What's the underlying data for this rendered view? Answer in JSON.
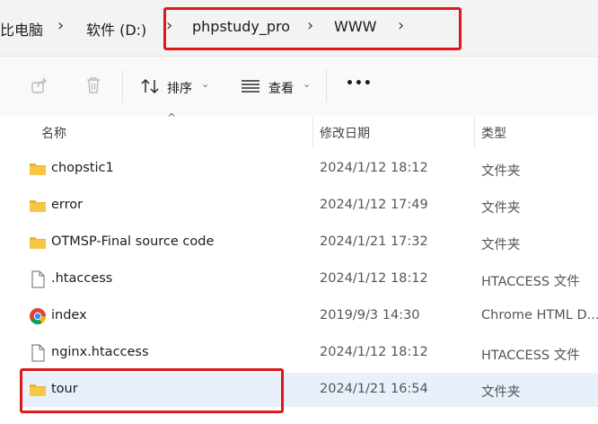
{
  "breadcrumb": {
    "items": [
      "比电脑",
      "软件 (D:)",
      "phpstudy_pro",
      "WWW"
    ]
  },
  "toolbar": {
    "sort_label": "排序",
    "view_label": "查看",
    "more_label": "•••"
  },
  "columns": {
    "name": "名称",
    "date": "修改日期",
    "type": "类型"
  },
  "files": [
    {
      "name": "chopstic1",
      "date": "2024/1/12 18:12",
      "type": "文件夹",
      "icon": "folder-icon"
    },
    {
      "name": "error",
      "date": "2024/1/12 17:49",
      "type": "文件夹",
      "icon": "folder-icon"
    },
    {
      "name": "OTMSP-Final source code",
      "date": "2024/1/21 17:32",
      "type": "文件夹",
      "icon": "folder-icon"
    },
    {
      "name": ".htaccess",
      "date": "2024/1/12 18:12",
      "type": "HTACCESS 文件",
      "icon": "file-icon"
    },
    {
      "name": "index",
      "date": "2019/9/3 14:30",
      "type": "Chrome HTML D...",
      "icon": "chrome-icon"
    },
    {
      "name": "nginx.htaccess",
      "date": "2024/1/12 18:12",
      "type": "HTACCESS 文件",
      "icon": "file-icon"
    },
    {
      "name": "tour",
      "date": "2024/1/21 16:54",
      "type": "文件夹",
      "icon": "folder-icon"
    }
  ],
  "colors": {
    "highlight": "#e0161a",
    "selected_row": "#e8f1fb",
    "folder": "#f3c13a"
  }
}
